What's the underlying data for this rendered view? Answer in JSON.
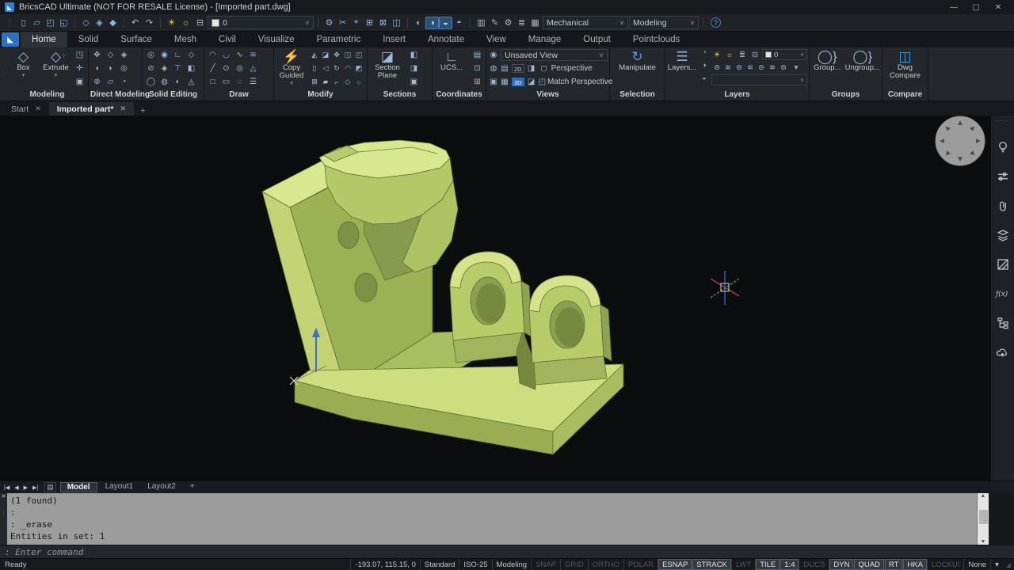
{
  "title_bar": {
    "logo_glyph": "◣",
    "title": "BricsCAD Ultimate (NOT FOR RESALE License) - [Imported part.dwg]",
    "minimize": "—",
    "maximize": "▢",
    "close": "✕"
  },
  "qat": {
    "grip": "⋮",
    "file_icons": [
      "▯",
      "▱",
      "◰",
      "◱"
    ],
    "block_icons": [
      "◇",
      "◈",
      "◆"
    ],
    "undo": "↶",
    "redo": "↷",
    "bulb": "☀",
    "sun": "☼",
    "print": "⊟",
    "layer_value": "0",
    "chev": "∨",
    "tool_icons": [
      "⚙",
      "✂",
      "⌖",
      "⊞",
      "⊠",
      "◫"
    ],
    "sphere_icons": [
      {
        "t": "◐",
        "s": "plain"
      },
      {
        "t": "◑",
        "s": "on"
      },
      {
        "t": "◒",
        "s": "on"
      },
      {
        "t": "◓",
        "s": "plain"
      }
    ],
    "panel_icons": [
      "▥",
      "✎",
      "⚙",
      "≣",
      "▦"
    ],
    "workspace_value": "Mechanical",
    "profile_value": "Modeling",
    "help": "?"
  },
  "ribbon": {
    "tabs": [
      {
        "t": "Home",
        "s": "on"
      },
      {
        "t": "Solid",
        "s": "plain"
      },
      {
        "t": "Surface",
        "s": "plain"
      },
      {
        "t": "Mesh",
        "s": "plain"
      },
      {
        "t": "Civil",
        "s": "plain"
      },
      {
        "t": "Visualize",
        "s": "plain"
      },
      {
        "t": "Parametric",
        "s": "plain"
      },
      {
        "t": "Insert",
        "s": "plain"
      },
      {
        "t": "Annotate",
        "s": "plain"
      },
      {
        "t": "View",
        "s": "plain"
      },
      {
        "t": "Manage",
        "s": "plain"
      },
      {
        "t": "Output",
        "s": "plain"
      },
      {
        "t": "Pointclouds",
        "s": "plain"
      }
    ],
    "modeling": {
      "label": "Modeling",
      "box": "Box",
      "extrude": "Extrude",
      "box_icon": "◇",
      "extrude_icon": "◇",
      "extrude_arrow": "↑",
      "caret": "▾",
      "side_icons": [
        "◳",
        "✛",
        "▣"
      ]
    },
    "direct": {
      "label": "Direct Modeling",
      "grid": [
        "✥",
        "◇",
        "◈",
        "◖",
        "◗",
        "◎",
        "⊕",
        "▱",
        "◔"
      ]
    },
    "solid": {
      "label": "Solid Editing",
      "grid": [
        "◎",
        "◉",
        "∟",
        "◇",
        "⊘",
        "◈",
        "⊤",
        "◧",
        "◯",
        "◍",
        "◐",
        "◬"
      ]
    },
    "draw": {
      "label": "Draw",
      "grid": [
        "◠",
        "◡",
        "∿",
        "≋",
        "╱",
        "⊙",
        "◎",
        "△",
        "□",
        "▭",
        "◌",
        "☰"
      ]
    },
    "modify": {
      "label": "Modify",
      "big": "Copy Guided",
      "big_icon": "⚡",
      "caret": "▾",
      "grid": [
        "◭",
        "◪",
        "✥",
        "◫",
        "◰",
        "▯",
        "◁",
        "↻",
        "◠",
        "◩",
        "⊠",
        "▰",
        "⌐",
        "◇",
        "○"
      ]
    },
    "sections": {
      "label": "Sections",
      "big": "Section Plane",
      "big_icon": "◪",
      "side_icons": [
        "◧",
        "◨",
        "▣"
      ]
    },
    "coords": {
      "label": "Coordinates",
      "big": "UCS...",
      "big_icon": "∟",
      "side_icons": [
        "▤",
        "⊡",
        "⊞"
      ]
    },
    "views": {
      "label": "Views",
      "eye_icon": "◉",
      "value": "Unsaved View",
      "chev": "∨",
      "row2_icons": [
        "◍",
        "▤"
      ],
      "chip_2d": "2D",
      "row2b_icons": [
        "◨"
      ],
      "persp_icon": "◻",
      "persp": "Perspective",
      "row3_icons": [
        "▣",
        "▦"
      ],
      "chip_3d": "3D",
      "row3b_icons": [
        "◪"
      ],
      "match_icon": "◰",
      "match": "Match Perspective"
    },
    "selection": {
      "label": "Selection",
      "big": "Manipulate",
      "big_icon": "↻"
    },
    "layers": {
      "label": "Layers",
      "big": "Layers...",
      "big_icon": "☰",
      "col_icons": [
        "◔",
        "◑",
        "◒"
      ],
      "bulb": "☀",
      "sun": "☼",
      "freeze": "≣",
      "print": "⊟",
      "value": "0",
      "chev": "∨",
      "row2_icons": [
        "⊜",
        "≋",
        "⊜",
        "≋",
        "⊜",
        "≋",
        "⊜"
      ],
      "caret": "▾"
    },
    "groups": {
      "label": "Groups",
      "group": "Group...",
      "ungroup": "Ungroup...",
      "icon": "◯}"
    },
    "compare": {
      "label": "Compare",
      "line1": "Dwg",
      "line2": "Compare",
      "icon": "◫"
    }
  },
  "doc_tabs": {
    "start": "Start",
    "active": "Imported part*",
    "close": "✕",
    "add": "+"
  },
  "viewport": {
    "bg": "#0c0d0f",
    "part_colors": {
      "top": "#d9e78e",
      "front": "#b5c867",
      "inner": "#9cb054",
      "hole": "#8ca050"
    }
  },
  "side_panel": {
    "handle": "····",
    "fx_label": "ƒ(x)"
  },
  "layout_bar": {
    "nav": [
      "|◀",
      "◀",
      "▶",
      "▶|"
    ],
    "sheet_icon": "▤",
    "tabs": [
      {
        "t": "Model",
        "s": "on"
      },
      {
        "t": "Layout1",
        "s": "plain"
      },
      {
        "t": "Layout2",
        "s": "plain"
      },
      {
        "t": "+",
        "s": "plain"
      }
    ]
  },
  "command": {
    "close": "✕",
    "grip": "⁞",
    "lines": [
      "(1 found)",
      ":",
      ": _erase",
      "Entities in set: 1"
    ],
    "prompt": ": Enter command",
    "scroll_up": "▲",
    "scroll_down": "▼"
  },
  "status": {
    "ready": "Ready",
    "items": [
      {
        "t": "-193.07, 115.15, 0",
        "s": "plain"
      },
      {
        "t": "Standard",
        "s": "plain"
      },
      {
        "t": "ISO-25",
        "s": "plain"
      },
      {
        "t": "Modeling",
        "s": "plain"
      },
      {
        "t": "SNAP",
        "s": "off"
      },
      {
        "t": "GRID",
        "s": "off"
      },
      {
        "t": "ORTHO",
        "s": "off"
      },
      {
        "t": "POLAR",
        "s": "off"
      },
      {
        "t": "ESNAP",
        "s": "on"
      },
      {
        "t": "STRACK",
        "s": "on"
      },
      {
        "t": "LWT",
        "s": "off"
      },
      {
        "t": "TILE",
        "s": "on"
      },
      {
        "t": "1:4",
        "s": "on"
      },
      {
        "t": "DUCS",
        "s": "off"
      },
      {
        "t": "DYN",
        "s": "on"
      },
      {
        "t": "QUAD",
        "s": "on"
      },
      {
        "t": "RT",
        "s": "on"
      },
      {
        "t": "HKA",
        "s": "on"
      },
      {
        "t": "LOCKUI",
        "s": "off"
      },
      {
        "t": "None",
        "s": "plain"
      },
      {
        "t": "▾",
        "s": "plain"
      }
    ],
    "grip": "◢"
  }
}
